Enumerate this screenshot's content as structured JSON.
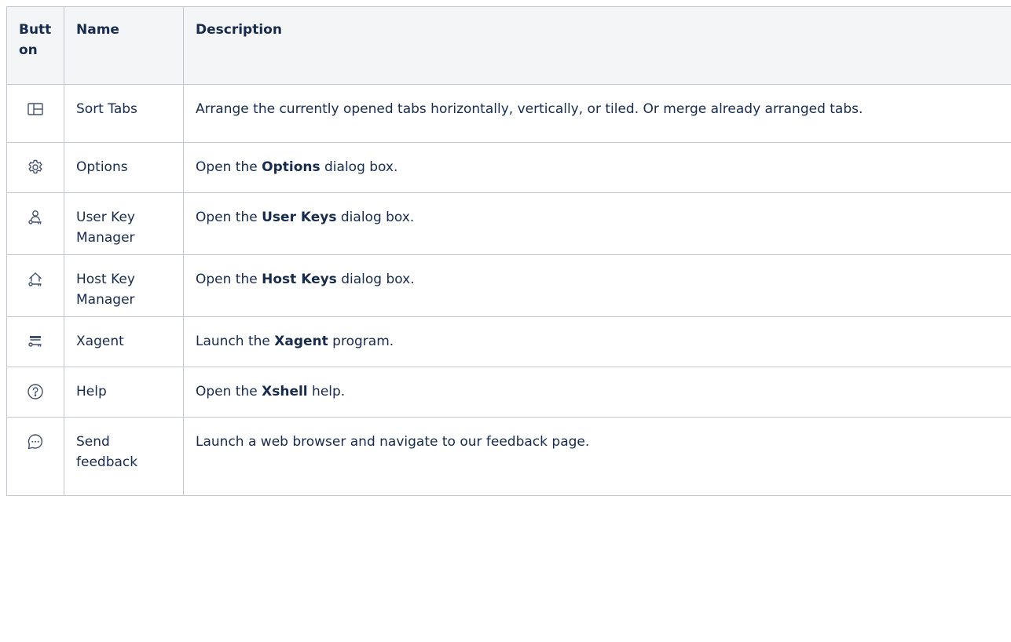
{
  "table": {
    "headers": {
      "button": "Button",
      "name": "Name",
      "description": "Description"
    },
    "rows": [
      {
        "icon": "split-layout-icon",
        "name": "Sort Tabs",
        "desc_pre": "Arrange the currently opened tabs horizontally, vertically, or tiled. Or merge already arranged tabs.",
        "desc_bold": "",
        "desc_post": ""
      },
      {
        "icon": "gear-icon",
        "name": "Options",
        "desc_pre": "Open the ",
        "desc_bold": "Options",
        "desc_post": " dialog box."
      },
      {
        "icon": "user-key-icon",
        "name": "User Key Manager",
        "desc_pre": "Open the ",
        "desc_bold": "User Keys",
        "desc_post": " dialog box."
      },
      {
        "icon": "host-key-icon",
        "name": "Host Key Manager",
        "desc_pre": "Open the ",
        "desc_bold": "Host Keys",
        "desc_post": " dialog box."
      },
      {
        "icon": "agent-key-icon",
        "name": "Xagent",
        "desc_pre": "Launch the ",
        "desc_bold": "Xagent",
        "desc_post": " program."
      },
      {
        "icon": "help-icon",
        "name": "Help",
        "desc_pre": "Open the ",
        "desc_bold": "Xshell",
        "desc_post": " help."
      },
      {
        "icon": "feedback-icon",
        "name": "Send feedback",
        "desc_pre": "Launch a web browser and navigate to our feedback page.",
        "desc_bold": "",
        "desc_post": ""
      }
    ]
  },
  "colors": {
    "text": "#172b4d",
    "header_bg": "#f4f5f7",
    "border": "#c1c7d0",
    "icon": "#42526e"
  }
}
